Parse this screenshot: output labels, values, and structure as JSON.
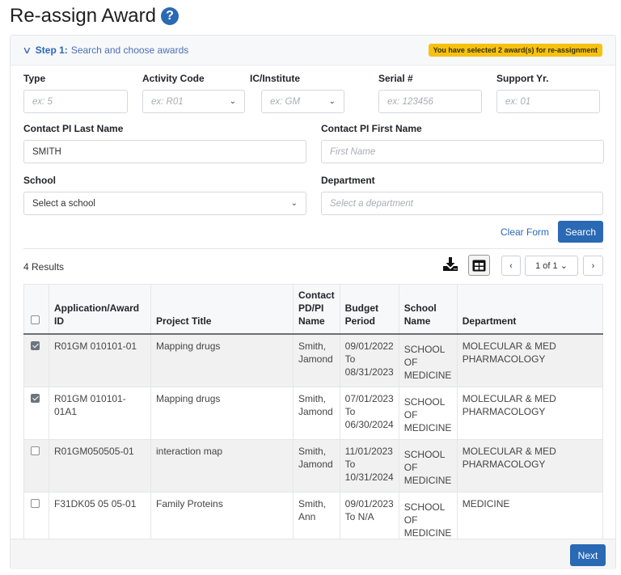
{
  "page": {
    "title": "Re-assign Award",
    "help_icon": "question-circle-icon"
  },
  "step": {
    "chevron_icon": "chevron-down-icon",
    "label_bold": "Step 1:",
    "label_text": "Search and choose awards",
    "selection_badge": "You have selected 2 award(s) for re-assignment"
  },
  "form": {
    "type": {
      "label": "Type",
      "placeholder": "ex: 5",
      "value": ""
    },
    "activity_code": {
      "label": "Activity Code",
      "placeholder": "ex: R01",
      "value": ""
    },
    "ic_institute": {
      "label": "IC/Institute",
      "placeholder": "ex: GM",
      "value": ""
    },
    "serial": {
      "label": "Serial #",
      "placeholder": "ex: 123456",
      "value": ""
    },
    "support_yr": {
      "label": "Support Yr.",
      "placeholder": "ex: 01",
      "value": ""
    },
    "pi_last_name": {
      "label": "Contact PI Last Name",
      "value": "SMITH"
    },
    "pi_first_name": {
      "label": "Contact PI First Name",
      "placeholder": "First Name",
      "value": ""
    },
    "school": {
      "label": "School",
      "selected": "Select a school"
    },
    "department": {
      "label": "Department",
      "placeholder": "Select a department"
    },
    "clear_label": "Clear Form",
    "search_label": "Search"
  },
  "results": {
    "count_label": "4 Results",
    "download_icon": "download-icon",
    "grid_icon": "table-view-icon",
    "pagination": {
      "prev": "‹",
      "page_label": "1 of 1",
      "next": "›"
    },
    "columns": [
      "Application/Award ID",
      "Project Title",
      "Contact PD/PI Name",
      "Budget Period",
      "School Name",
      "Department"
    ],
    "rows": [
      {
        "checked": true,
        "id": "R01GM 010101-01",
        "title": "Mapping  drugs",
        "pi": "Smith, Jamond",
        "budget_from": "09/01/2022",
        "budget_to": "To",
        "budget_end": "08/31/2023",
        "school": "SCHOOL OF MEDICINE",
        "department": "MOLECULAR & MED PHARMACOLOGY"
      },
      {
        "checked": true,
        "id": "R01GM 010101-01A1",
        "title": "Mapping  drugs",
        "pi": "Smith, Jamond",
        "budget_from": "07/01/2023",
        "budget_to": "To",
        "budget_end": "06/30/2024",
        "school": "SCHOOL OF MEDICINE",
        "department": "MOLECULAR & MED PHARMACOLOGY"
      },
      {
        "checked": false,
        "id": "R01GM050505-01",
        "title": "interaction map",
        "pi": "Smith, Jamond",
        "budget_from": "11/01/2023",
        "budget_to": "To",
        "budget_end": "10/31/2024",
        "school": "SCHOOL OF MEDICINE",
        "department": "MOLECULAR & MED PHARMACOLOGY"
      },
      {
        "checked": false,
        "id": "F31DK05 05 05-01",
        "title": "Family Proteins",
        "pi": "Smith, Ann",
        "budget_from": "09/01/2023",
        "budget_to": "To N/A",
        "budget_end": "",
        "school": "SCHOOL OF MEDICINE",
        "department": "MEDICINE"
      }
    ]
  },
  "footer": {
    "next_label": "Next"
  }
}
